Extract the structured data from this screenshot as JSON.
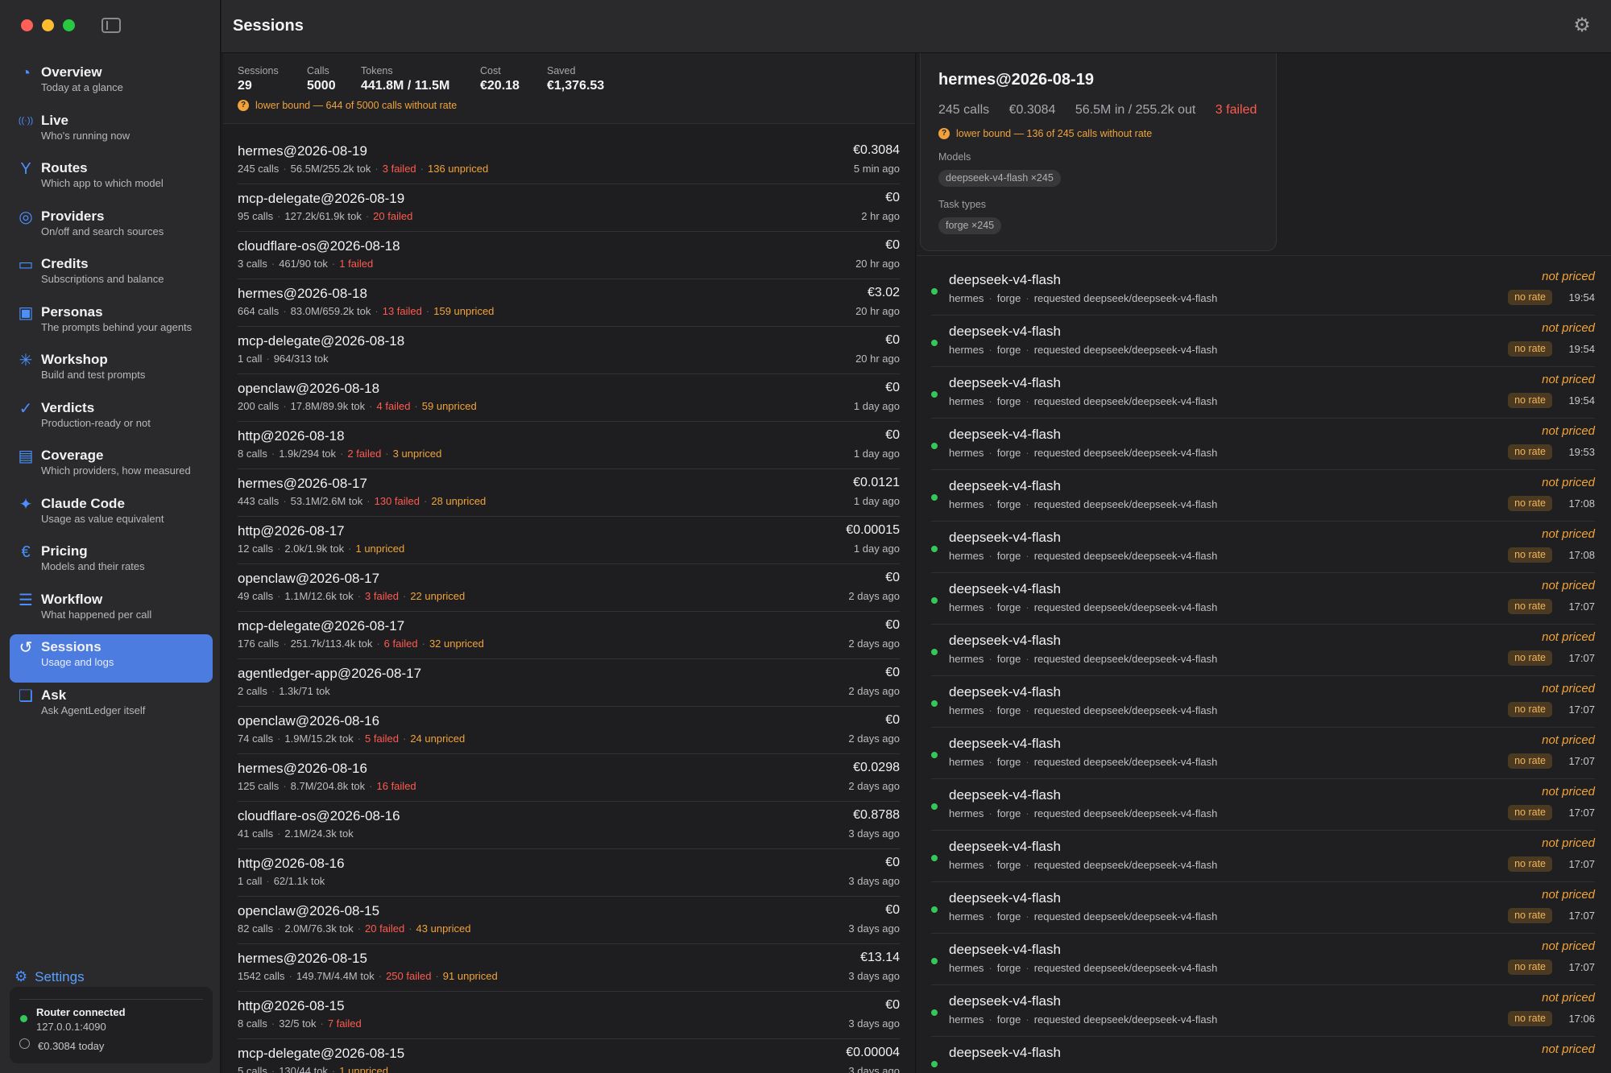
{
  "app": {
    "page_title": "Sessions"
  },
  "sidebar": {
    "items": [
      {
        "label": "Overview",
        "sub": "Today at a glance",
        "icon": "overview-icon",
        "glyph": "◔",
        "active": false
      },
      {
        "label": "Live",
        "sub": "Who's running now",
        "icon": "live-icon",
        "glyph": "((·))",
        "active": false
      },
      {
        "label": "Routes",
        "sub": "Which app to which model",
        "icon": "routes-icon",
        "glyph": "Y",
        "active": false
      },
      {
        "label": "Providers",
        "sub": "On/off and search sources",
        "icon": "providers-icon",
        "glyph": "◎",
        "active": false
      },
      {
        "label": "Credits",
        "sub": "Subscriptions and balance",
        "icon": "credits-icon",
        "glyph": "▭",
        "active": false
      },
      {
        "label": "Personas",
        "sub": "The prompts behind your agents",
        "icon": "personas-icon",
        "glyph": "▣",
        "active": false
      },
      {
        "label": "Workshop",
        "sub": "Build and test prompts",
        "icon": "workshop-icon",
        "glyph": "✳",
        "active": false
      },
      {
        "label": "Verdicts",
        "sub": "Production-ready or not",
        "icon": "verdicts-icon",
        "glyph": "✓",
        "active": false
      },
      {
        "label": "Coverage",
        "sub": "Which providers, how measured",
        "icon": "coverage-icon",
        "glyph": "▤",
        "active": false
      },
      {
        "label": "Claude Code",
        "sub": "Usage as value equivalent",
        "icon": "sparkle-icon",
        "glyph": "✦",
        "active": false
      },
      {
        "label": "Pricing",
        "sub": "Models and their rates",
        "icon": "euro-icon",
        "glyph": "€",
        "active": false
      },
      {
        "label": "Workflow",
        "sub": "What happened per call",
        "icon": "workflow-icon",
        "glyph": "☰",
        "active": false
      },
      {
        "label": "Sessions",
        "sub": "Usage and logs",
        "icon": "history-icon",
        "glyph": "↺",
        "active": true
      },
      {
        "label": "Ask",
        "sub": "Ask AgentLedger itself",
        "icon": "chat-icon",
        "glyph": "❏",
        "active": false
      }
    ],
    "settings_label": "Settings",
    "router": {
      "status": "Router connected",
      "address": "127.0.0.1:4090",
      "cost_today": "€0.3084 today"
    }
  },
  "summary": {
    "stats": [
      {
        "label": "Sessions",
        "value": "29"
      },
      {
        "label": "Calls",
        "value": "5000"
      },
      {
        "label": "Tokens",
        "value": "441.8M / 11.5M"
      },
      {
        "label": "Cost",
        "value": "€20.18"
      },
      {
        "label": "Saved",
        "value": "€1,376.53"
      }
    ],
    "warning": "lower bound — 644 of 5000 calls without rate"
  },
  "sessions": [
    {
      "name": "hermes@2026-08-19",
      "calls": "245 calls",
      "tokens": "56.5M/255.2k tok",
      "failed": "3 failed",
      "unpriced": "136 unpriced",
      "cost": "€0.3084",
      "time": "5 min ago"
    },
    {
      "name": "mcp-delegate@2026-08-19",
      "calls": "95 calls",
      "tokens": "127.2k/61.9k tok",
      "failed": "20 failed",
      "unpriced": "",
      "cost": "€0",
      "time": "2 hr ago"
    },
    {
      "name": "cloudflare-os@2026-08-18",
      "calls": "3 calls",
      "tokens": "461/90 tok",
      "failed": "1 failed",
      "unpriced": "",
      "cost": "€0",
      "time": "20 hr ago"
    },
    {
      "name": "hermes@2026-08-18",
      "calls": "664 calls",
      "tokens": "83.0M/659.2k tok",
      "failed": "13 failed",
      "unpriced": "159 unpriced",
      "cost": "€3.02",
      "time": "20 hr ago"
    },
    {
      "name": "mcp-delegate@2026-08-18",
      "calls": "1 call",
      "tokens": "964/313 tok",
      "failed": "",
      "unpriced": "",
      "cost": "€0",
      "time": "20 hr ago"
    },
    {
      "name": "openclaw@2026-08-18",
      "calls": "200 calls",
      "tokens": "17.8M/89.9k tok",
      "failed": "4 failed",
      "unpriced": "59 unpriced",
      "cost": "€0",
      "time": "1 day ago"
    },
    {
      "name": "http@2026-08-18",
      "calls": "8 calls",
      "tokens": "1.9k/294 tok",
      "failed": "2 failed",
      "unpriced": "3 unpriced",
      "cost": "€0",
      "time": "1 day ago"
    },
    {
      "name": "hermes@2026-08-17",
      "calls": "443 calls",
      "tokens": "53.1M/2.6M tok",
      "failed": "130 failed",
      "unpriced": "28 unpriced",
      "cost": "€0.0121",
      "time": "1 day ago"
    },
    {
      "name": "http@2026-08-17",
      "calls": "12 calls",
      "tokens": "2.0k/1.9k tok",
      "failed": "",
      "unpriced": "1 unpriced",
      "cost": "€0.00015",
      "time": "1 day ago"
    },
    {
      "name": "openclaw@2026-08-17",
      "calls": "49 calls",
      "tokens": "1.1M/12.6k tok",
      "failed": "3 failed",
      "unpriced": "22 unpriced",
      "cost": "€0",
      "time": "2 days ago"
    },
    {
      "name": "mcp-delegate@2026-08-17",
      "calls": "176 calls",
      "tokens": "251.7k/113.4k tok",
      "failed": "6 failed",
      "unpriced": "32 unpriced",
      "cost": "€0",
      "time": "2 days ago"
    },
    {
      "name": "agentledger-app@2026-08-17",
      "calls": "2 calls",
      "tokens": "1.3k/71 tok",
      "failed": "",
      "unpriced": "",
      "cost": "€0",
      "time": "2 days ago"
    },
    {
      "name": "openclaw@2026-08-16",
      "calls": "74 calls",
      "tokens": "1.9M/15.2k tok",
      "failed": "5 failed",
      "unpriced": "24 unpriced",
      "cost": "€0",
      "time": "2 days ago"
    },
    {
      "name": "hermes@2026-08-16",
      "calls": "125 calls",
      "tokens": "8.7M/204.8k tok",
      "failed": "16 failed",
      "unpriced": "",
      "cost": "€0.0298",
      "time": "2 days ago"
    },
    {
      "name": "cloudflare-os@2026-08-16",
      "calls": "41 calls",
      "tokens": "2.1M/24.3k tok",
      "failed": "",
      "unpriced": "",
      "cost": "€0.8788",
      "time": "3 days ago"
    },
    {
      "name": "http@2026-08-16",
      "calls": "1 call",
      "tokens": "62/1.1k tok",
      "failed": "",
      "unpriced": "",
      "cost": "€0",
      "time": "3 days ago"
    },
    {
      "name": "openclaw@2026-08-15",
      "calls": "82 calls",
      "tokens": "2.0M/76.3k tok",
      "failed": "20 failed",
      "unpriced": "43 unpriced",
      "cost": "€0",
      "time": "3 days ago"
    },
    {
      "name": "hermes@2026-08-15",
      "calls": "1542 calls",
      "tokens": "149.7M/4.4M tok",
      "failed": "250 failed",
      "unpriced": "91 unpriced",
      "cost": "€13.14",
      "time": "3 days ago"
    },
    {
      "name": "http@2026-08-15",
      "calls": "8 calls",
      "tokens": "32/5 tok",
      "failed": "7 failed",
      "unpriced": "",
      "cost": "€0",
      "time": "3 days ago"
    },
    {
      "name": "mcp-delegate@2026-08-15",
      "calls": "5 calls",
      "tokens": "130/44 tok",
      "failed": "",
      "unpriced": "1 unpriced",
      "cost": "€0.00004",
      "time": "3 days ago"
    }
  ],
  "detail": {
    "title": "hermes@2026-08-19",
    "calls": "245 calls",
    "cost": "€0.3084",
    "tokens": "56.5M in / 255.2k out",
    "failed": "3 failed",
    "warning": "lower bound — 136 of 245 calls without rate",
    "models_label": "Models",
    "model_chip": "deepseek-v4-flash ×245",
    "task_types_label": "Task types",
    "task_chip": "forge ×245"
  },
  "calls": [
    {
      "model": "deepseek-v4-flash",
      "app": "hermes",
      "task": "forge",
      "requested": "requested deepseek/deepseek-v4-flash",
      "status": "not priced",
      "badge": "no rate",
      "time": "19:54"
    },
    {
      "model": "deepseek-v4-flash",
      "app": "hermes",
      "task": "forge",
      "requested": "requested deepseek/deepseek-v4-flash",
      "status": "not priced",
      "badge": "no rate",
      "time": "19:54"
    },
    {
      "model": "deepseek-v4-flash",
      "app": "hermes",
      "task": "forge",
      "requested": "requested deepseek/deepseek-v4-flash",
      "status": "not priced",
      "badge": "no rate",
      "time": "19:54"
    },
    {
      "model": "deepseek-v4-flash",
      "app": "hermes",
      "task": "forge",
      "requested": "requested deepseek/deepseek-v4-flash",
      "status": "not priced",
      "badge": "no rate",
      "time": "19:53"
    },
    {
      "model": "deepseek-v4-flash",
      "app": "hermes",
      "task": "forge",
      "requested": "requested deepseek/deepseek-v4-flash",
      "status": "not priced",
      "badge": "no rate",
      "time": "17:08"
    },
    {
      "model": "deepseek-v4-flash",
      "app": "hermes",
      "task": "forge",
      "requested": "requested deepseek/deepseek-v4-flash",
      "status": "not priced",
      "badge": "no rate",
      "time": "17:08"
    },
    {
      "model": "deepseek-v4-flash",
      "app": "hermes",
      "task": "forge",
      "requested": "requested deepseek/deepseek-v4-flash",
      "status": "not priced",
      "badge": "no rate",
      "time": "17:07"
    },
    {
      "model": "deepseek-v4-flash",
      "app": "hermes",
      "task": "forge",
      "requested": "requested deepseek/deepseek-v4-flash",
      "status": "not priced",
      "badge": "no rate",
      "time": "17:07"
    },
    {
      "model": "deepseek-v4-flash",
      "app": "hermes",
      "task": "forge",
      "requested": "requested deepseek/deepseek-v4-flash",
      "status": "not priced",
      "badge": "no rate",
      "time": "17:07"
    },
    {
      "model": "deepseek-v4-flash",
      "app": "hermes",
      "task": "forge",
      "requested": "requested deepseek/deepseek-v4-flash",
      "status": "not priced",
      "badge": "no rate",
      "time": "17:07"
    },
    {
      "model": "deepseek-v4-flash",
      "app": "hermes",
      "task": "forge",
      "requested": "requested deepseek/deepseek-v4-flash",
      "status": "not priced",
      "badge": "no rate",
      "time": "17:07"
    },
    {
      "model": "deepseek-v4-flash",
      "app": "hermes",
      "task": "forge",
      "requested": "requested deepseek/deepseek-v4-flash",
      "status": "not priced",
      "badge": "no rate",
      "time": "17:07"
    },
    {
      "model": "deepseek-v4-flash",
      "app": "hermes",
      "task": "forge",
      "requested": "requested deepseek/deepseek-v4-flash",
      "status": "not priced",
      "badge": "no rate",
      "time": "17:07"
    },
    {
      "model": "deepseek-v4-flash",
      "app": "hermes",
      "task": "forge",
      "requested": "requested deepseek/deepseek-v4-flash",
      "status": "not priced",
      "badge": "no rate",
      "time": "17:07"
    },
    {
      "model": "deepseek-v4-flash",
      "app": "hermes",
      "task": "forge",
      "requested": "requested deepseek/deepseek-v4-flash",
      "status": "not priced",
      "badge": "no rate",
      "time": "17:06"
    },
    {
      "model": "deepseek-v4-flash",
      "app": "",
      "task": "",
      "requested": "",
      "status": "not priced",
      "badge": "",
      "time": ""
    }
  ]
}
